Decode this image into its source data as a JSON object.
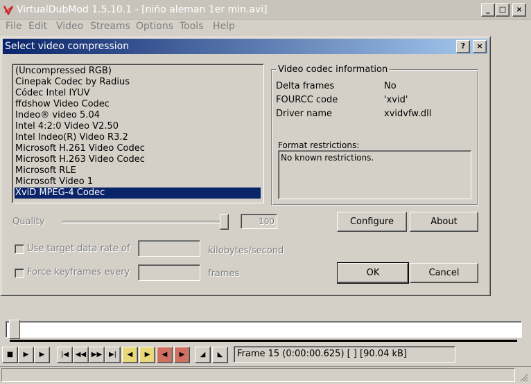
{
  "main_window": {
    "title": "VirtualDubMod 1.5.10.1 - [niño aleman 1er min.avi]",
    "app_icon": "virtualdub-icon",
    "buttons": {
      "minimize": "_",
      "maximize": "□",
      "close": "×"
    }
  },
  "menu": [
    "File",
    "Edit",
    "Video",
    "Streams",
    "Options",
    "Tools",
    "Help"
  ],
  "dialog": {
    "title": "Select video compression",
    "help_label": "?",
    "close_label": "×",
    "codecs": [
      "(Uncompressed RGB)",
      "Cinepak Codec by Radius",
      "Códec Intel IYUV",
      "ffdshow Video Codec",
      "Indeo® video 5.04",
      "Intel 4:2:0 Video V2.50",
      "Intel Indeo(R) Video R3.2",
      "Microsoft H.261 Video Codec",
      "Microsoft H.263 Video Codec",
      "Microsoft RLE",
      "Microsoft Video 1",
      "XviD MPEG-4 Codec"
    ],
    "selected_index": 11,
    "info": {
      "legend": "Video codec information",
      "delta_frames_label": "Delta frames",
      "delta_frames_value": "No",
      "fourcc_label": "FOURCC code",
      "fourcc_value": "'xvid'",
      "driver_label": "Driver name",
      "driver_value": "xvidvfw.dll",
      "restrictions_label": "Format restrictions:",
      "restrictions_value": "No known restrictions."
    },
    "quality_label": "Quality",
    "quality_value": "100",
    "quality_fraction": 1.0,
    "configure_label": "Configure",
    "about_label": "About",
    "target_rate_label": "Use target data rate of",
    "target_rate_unit": "kilobytes/second",
    "keyframes_label": "Force keyframes every",
    "keyframes_unit": "frames",
    "ok_label": "OK",
    "cancel_label": "Cancel"
  },
  "frame_status": "Frame 15 (0:00:00.625) [ ] [90.04 kB]",
  "timeline_position_fraction": 0.0
}
